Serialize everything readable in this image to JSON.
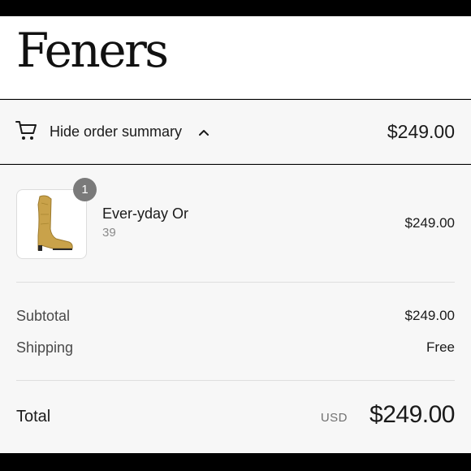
{
  "brand": "Feners",
  "summary_bar": {
    "toggle_label": "Hide order summary",
    "total": "$249.00"
  },
  "line_item": {
    "quantity": "1",
    "name": "Ever-yday Or",
    "variant": "39",
    "price": "$249.00",
    "image_icon": "cowboy-boot-icon"
  },
  "costs": {
    "subtotal_label": "Subtotal",
    "subtotal_value": "$249.00",
    "shipping_label": "Shipping",
    "shipping_value": "Free"
  },
  "total": {
    "label": "Total",
    "currency": "USD",
    "amount": "$249.00"
  },
  "icons": {
    "cart": "cart-icon",
    "chevron": "chevron-up-icon"
  },
  "colors": {
    "panel_bg": "#f7f7f7",
    "badge_bg": "#7a7a7a",
    "boot_gold": "#c9a24a"
  }
}
